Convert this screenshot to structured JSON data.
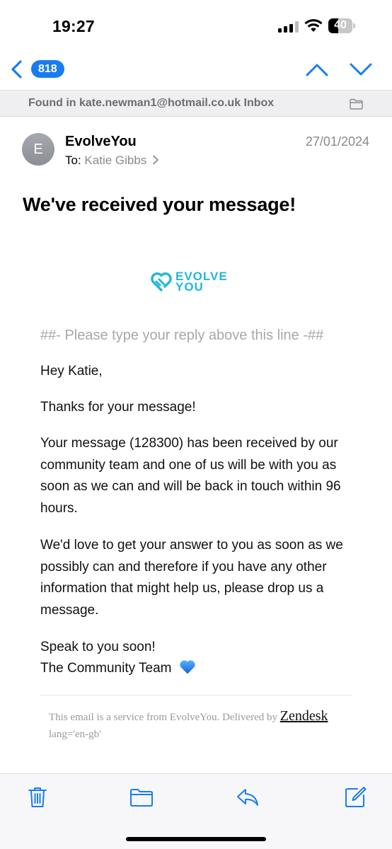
{
  "status_bar": {
    "time": "19:27",
    "battery": "40",
    "battery_level": 0.4
  },
  "nav": {
    "count_badge": "818",
    "accent_color": "#1a7cf0"
  },
  "found_in": {
    "text": "Found in kate.newman1@hotmail.co.uk Inbox"
  },
  "message": {
    "avatar_initial": "E",
    "sender": "EvolveYou",
    "to_label": "To:",
    "to_name": "Katie Gibbs",
    "date": "27/01/2024",
    "subject": "We've received your message!"
  },
  "logo": {
    "line1": "EVOLVE",
    "line2": "YOU",
    "brand_color": "#21b8d8"
  },
  "body": {
    "reply_line": "##- Please type your reply above this line -##",
    "greeting": "Hey Katie,",
    "thanks": "Thanks for your message!",
    "para1": "Your message (128300) has been received by our community team and one of us will be with you as soon as we can and will be back in touch within 96 hours.",
    "para2": "We'd love to get your answer to you as soon as we possibly can and therefore if you have any other information that might help us, please drop us a message.",
    "signoff1": "Speak to you soon!",
    "signoff2": "The Community Team",
    "heart_icon": "blue-heart-icon"
  },
  "footer": {
    "service_text": "This email is a service from EvolveYou. Delivered by",
    "zendesk": "Zendesk",
    "lang": "lang='en-gb'"
  },
  "toolbar": {
    "icons": [
      "trash-icon",
      "folder-icon",
      "reply-icon",
      "compose-icon"
    ]
  }
}
